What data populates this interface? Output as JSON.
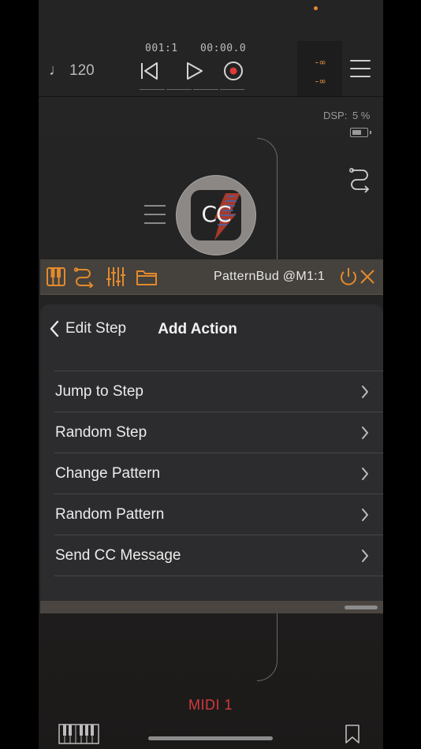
{
  "transport": {
    "tempo_value": "120",
    "position": "001:1",
    "time": "00:00.0",
    "meter_top": "-∞",
    "meter_bottom": "-∞"
  },
  "system": {
    "dsp_label": "DSP:",
    "dsp_value": "5 %"
  },
  "node": {
    "label": "CC"
  },
  "plugin": {
    "title": "PatternBud @M1:1"
  },
  "panel": {
    "back_label": "Edit Step",
    "title": "Add Action",
    "items": [
      {
        "label": "Jump to Step"
      },
      {
        "label": "Random Step"
      },
      {
        "label": "Change Pattern"
      },
      {
        "label": "Random Pattern"
      },
      {
        "label": "Send CC Message"
      }
    ]
  },
  "footer": {
    "midi_label": "MIDI 1"
  },
  "colors": {
    "accent_orange": "#e28a2b",
    "midi_red": "#d3393c",
    "record_red": "#e03a3a"
  }
}
